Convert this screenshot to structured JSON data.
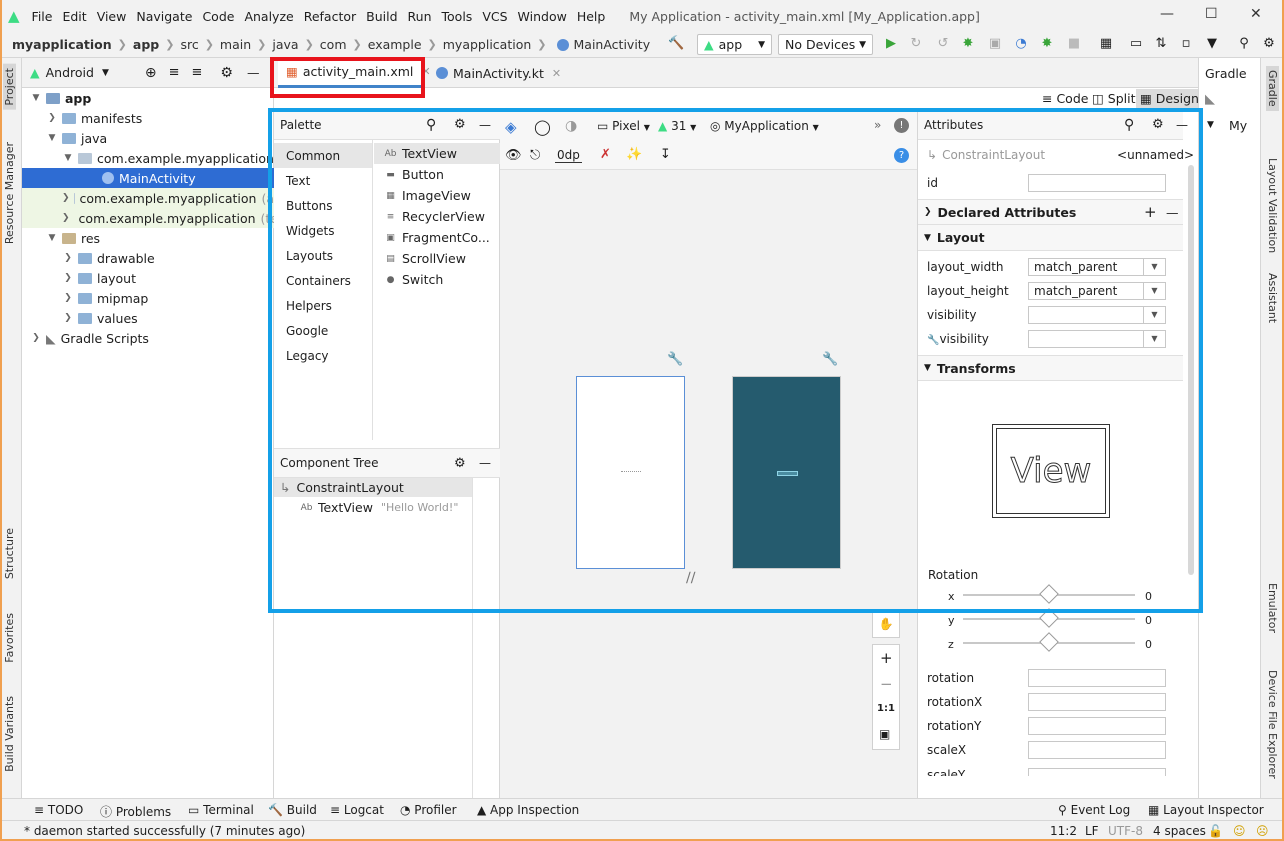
{
  "window": {
    "title": "My Application - activity_main.xml [My_Application.app]"
  },
  "menu": [
    "File",
    "Edit",
    "View",
    "Navigate",
    "Code",
    "Analyze",
    "Refactor",
    "Build",
    "Run",
    "Tools",
    "VCS",
    "Window",
    "Help"
  ],
  "breadcrumb": [
    "myapplication",
    "app",
    "src",
    "main",
    "java",
    "com",
    "example",
    "myapplication",
    "MainActivity"
  ],
  "toolbar": {
    "run_config": "app",
    "device": "No Devices"
  },
  "project": {
    "view_label": "Android",
    "tree": [
      {
        "label": "app",
        "bold": true
      },
      {
        "label": "manifests"
      },
      {
        "label": "java"
      },
      {
        "label": "com.example.myapplication"
      },
      {
        "label": "MainActivity"
      },
      {
        "label": "com.example.myapplication",
        "suffix": "(a"
      },
      {
        "label": "com.example.myapplication",
        "suffix": "(te"
      },
      {
        "label": "res"
      },
      {
        "label": "drawable"
      },
      {
        "label": "layout"
      },
      {
        "label": "mipmap"
      },
      {
        "label": "values"
      },
      {
        "label": "Gradle Scripts"
      }
    ]
  },
  "left_stripe": [
    "Project",
    "Resource Manager",
    "Structure",
    "Favorites",
    "Build Variants"
  ],
  "tabs": [
    {
      "label": "activity_main.xml"
    },
    {
      "label": "MainActivity.kt"
    }
  ],
  "modes": {
    "code": "Code",
    "split": "Split",
    "design": "Design"
  },
  "palette": {
    "title": "Palette",
    "categories": [
      "Common",
      "Text",
      "Buttons",
      "Widgets",
      "Layouts",
      "Containers",
      "Helpers",
      "Google",
      "Legacy"
    ],
    "items": [
      "TextView",
      "Button",
      "ImageView",
      "RecyclerView",
      "FragmentCo...",
      "ScrollView",
      "Switch"
    ]
  },
  "component_tree": {
    "title": "Component Tree",
    "root": "ConstraintLayout",
    "child": "TextView",
    "child_text": "\"Hello World!\""
  },
  "canvas_toolbar": {
    "device": "Pixel",
    "api": "31",
    "theme": "MyApplication",
    "margin": "0dp"
  },
  "attributes": {
    "title": "Attributes",
    "component": "ConstraintLayout",
    "component_name": "<unnamed>",
    "id_label": "id",
    "declared": "Declared Attributes",
    "layout_section": "Layout",
    "layout_width_label": "layout_width",
    "layout_width": "match_parent",
    "layout_height_label": "layout_height",
    "layout_height": "match_parent",
    "visibility_label": "visibility",
    "visibility2_label": "visibility",
    "transforms": "Transforms",
    "view_preview": "View",
    "rotation_header": "Rotation",
    "x_label": "x",
    "x_val": "0",
    "y_label": "y",
    "y_val": "0",
    "z_label": "z",
    "z_val": "0",
    "rotation": "rotation",
    "rotationX": "rotationX",
    "rotationY": "rotationY",
    "scaleX": "scaleX",
    "scaleY": "scaleY"
  },
  "gradle": {
    "title": "Gradle",
    "item": "My"
  },
  "right_stripe": [
    "Gradle",
    "Layout Validation",
    "Assistant",
    "Emulator",
    "Device File Explorer"
  ],
  "bottom_tools": [
    "TODO",
    "Problems",
    "Terminal",
    "Build",
    "Logcat",
    "Profiler",
    "App Inspection"
  ],
  "bottom_right": [
    "Event Log",
    "Layout Inspector"
  ],
  "status": {
    "message": "* daemon started successfully (7 minutes ago)",
    "position": "11:2",
    "eol": "LF",
    "encoding": "UTF-8",
    "indent": "4 spaces"
  }
}
